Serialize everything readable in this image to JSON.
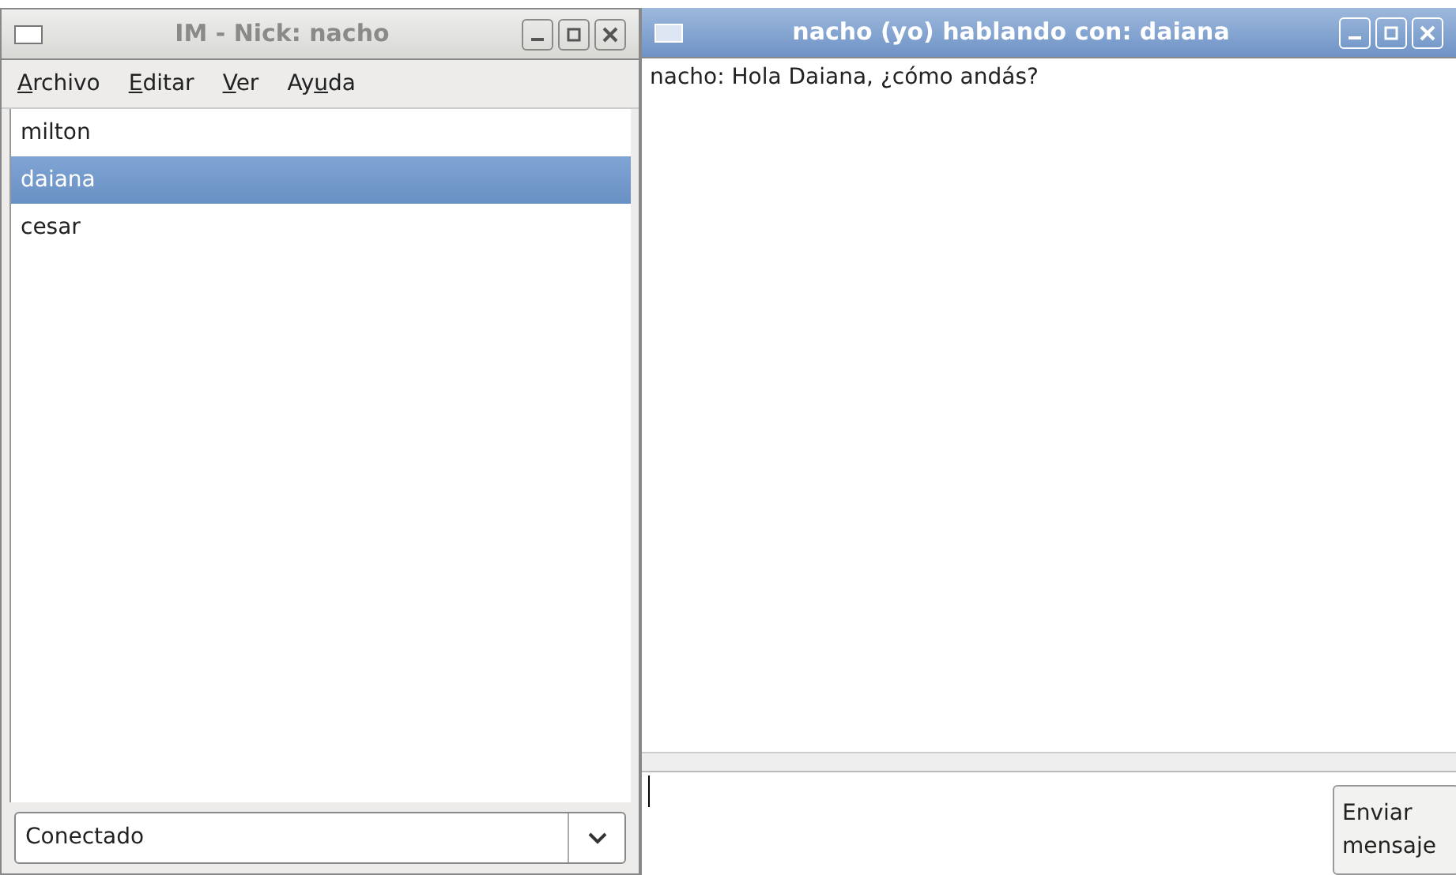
{
  "contacts_window": {
    "title": "IM - Nick: nacho",
    "active": false,
    "menu": [
      {
        "key": "A",
        "post": "rchivo"
      },
      {
        "key": "E",
        "post": "ditar"
      },
      {
        "key": "V",
        "post": "er"
      },
      {
        "pre": "Ay",
        "key": "u",
        "post": "da"
      }
    ],
    "contacts": [
      {
        "name": "milton",
        "selected": false
      },
      {
        "name": "daiana",
        "selected": true
      },
      {
        "name": "cesar",
        "selected": false
      }
    ],
    "status": {
      "value": "Conectado"
    }
  },
  "chat_window": {
    "title": "nacho (yo) hablando con: daiana",
    "active": true,
    "messages": [
      "nacho: Hola Daiana, ¿cómo andás?"
    ],
    "send_button": "Enviar mensaje"
  }
}
